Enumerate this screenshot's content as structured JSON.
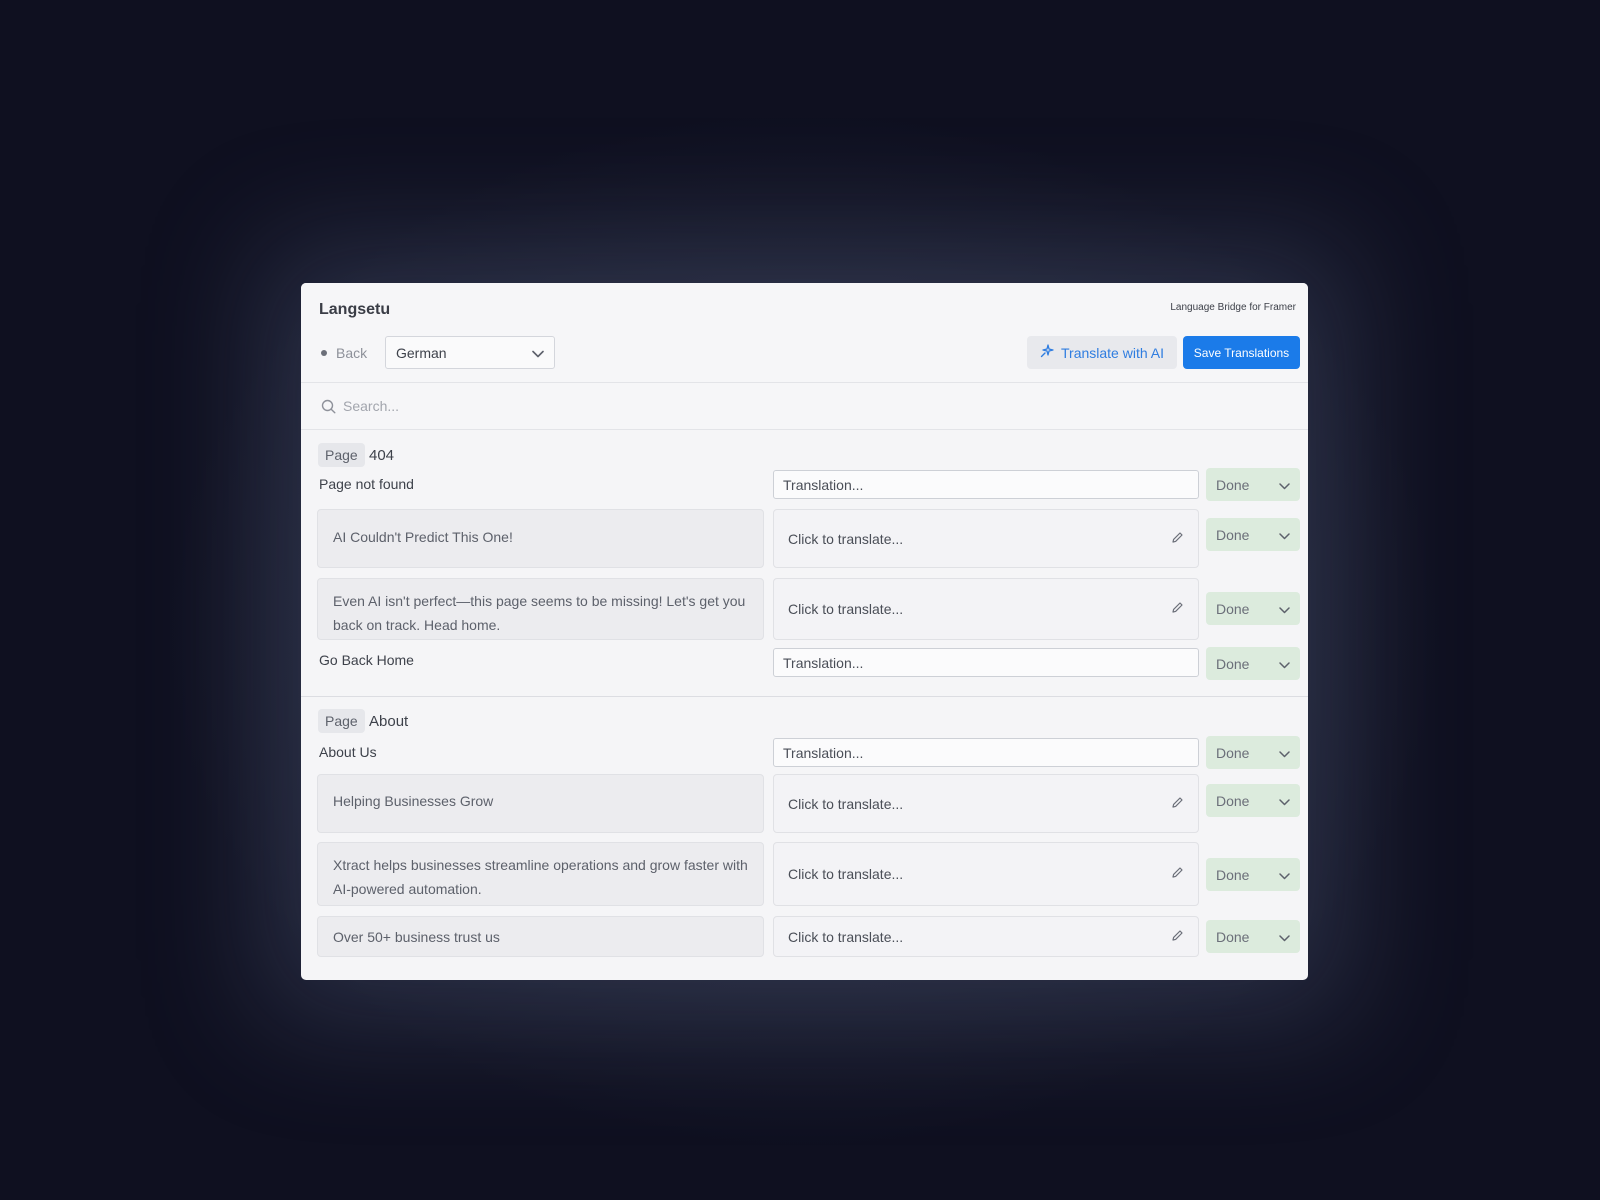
{
  "app": {
    "title": "Langsetu",
    "subtitle": "Language Bridge for Framer"
  },
  "toolbar": {
    "back_label": "Back",
    "language_selected": "German",
    "translate_ai_label": "Translate with AI",
    "save_label": "Save Translations"
  },
  "search": {
    "placeholder": "Search..."
  },
  "sections": [
    {
      "badge": "Page",
      "name": "404",
      "rows": [
        {
          "source": "Page not found",
          "translation_placeholder": "Translation...",
          "status": "Done"
        },
        {
          "source": "AI Couldn't Predict This One!",
          "translation_placeholder": "Click to translate...",
          "status": "Done"
        },
        {
          "source": "Even AI isn't perfect—this page seems to be missing! Let's get you back on track. Head home.",
          "translation_placeholder": "Click to translate...",
          "status": "Done"
        },
        {
          "source": "Go Back Home",
          "translation_placeholder": "Translation...",
          "status": "Done"
        }
      ]
    },
    {
      "badge": "Page",
      "name": "About",
      "rows": [
        {
          "source": "About Us",
          "translation_placeholder": "Translation...",
          "status": "Done"
        },
        {
          "source": "Helping Businesses Grow",
          "translation_placeholder": "Click to translate...",
          "status": "Done"
        },
        {
          "source": "Xtract helps businesses streamline operations and grow faster with AI-powered automation.",
          "translation_placeholder": "Click to translate...",
          "status": "Done"
        },
        {
          "source": "Over 50+ business trust us",
          "translation_placeholder": "Click to translate...",
          "status": "Done"
        }
      ]
    }
  ],
  "colors": {
    "accent": "#1b7be9",
    "ai_text": "#2f7de0",
    "status_done_bg": "#dcebdd",
    "backdrop": "#0f1020"
  },
  "icons": [
    "chevron-down-icon",
    "sparkle-icon",
    "search-icon",
    "pencil-icon"
  ]
}
